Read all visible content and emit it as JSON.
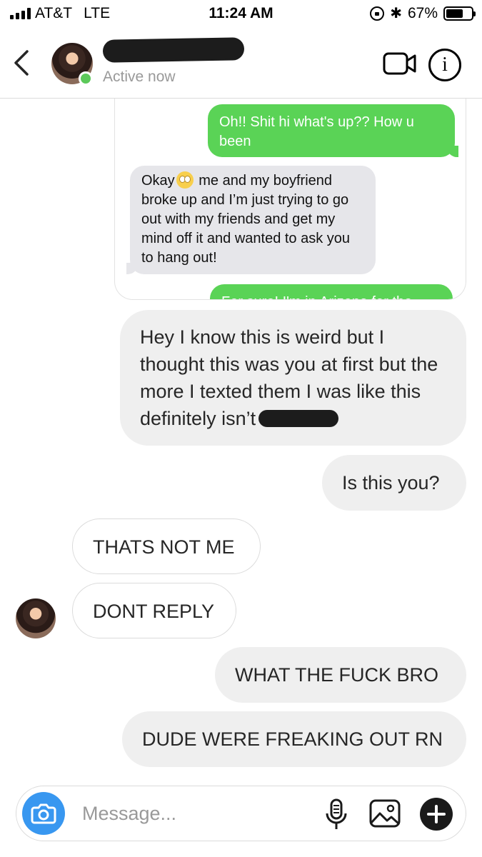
{
  "status_bar": {
    "carrier": "AT&T",
    "network": "LTE",
    "time": "11:24 AM",
    "battery": "67%",
    "battery_level": 0.67
  },
  "header": {
    "status": "Active now",
    "name_redacted": true
  },
  "embedded_screenshot": {
    "messages": [
      {
        "from": "me",
        "text": "Oh!! Shit hi what's up?? How u been"
      },
      {
        "from": "them",
        "text_before_emoji": "Okay",
        "emoji": "flushed-face-icon",
        "text_after_emoji": " me and my boyfriend broke up and I’m just trying to go out with my friends and get my mind off it and wanted to ask you to hang out!"
      },
      {
        "from": "me",
        "text": "For sure! I'm in Arizona for the"
      }
    ]
  },
  "messages": [
    {
      "from": "me",
      "text": "Hey I know this is weird but I thought this was you at first but the more I texted them I was like this definitely isn’t",
      "redacted_tail": true
    },
    {
      "from": "me",
      "text": "Is this you?"
    },
    {
      "from": "them",
      "text": "THATS NOT ME"
    },
    {
      "from": "them",
      "text": "DONT REPLY"
    },
    {
      "from": "me",
      "text": "WHAT THE FUCK BRO"
    },
    {
      "from": "me",
      "text": "DUDE WERE FREAKING OUT RN"
    }
  ],
  "composer": {
    "placeholder": "Message...",
    "value": ""
  },
  "icons": {
    "back": "chevron-left-icon",
    "video": "video-call-icon",
    "info": "info-icon",
    "camera": "camera-icon",
    "mic": "microphone-icon",
    "gallery": "gallery-icon",
    "plus": "plus-icon"
  },
  "colors": {
    "active_dot": "#5cc95a",
    "sms_outgoing": "#5ad356",
    "sms_incoming": "#e6e6ea",
    "bubble_gray": "#efefef",
    "camera_button": "#3897f0"
  }
}
